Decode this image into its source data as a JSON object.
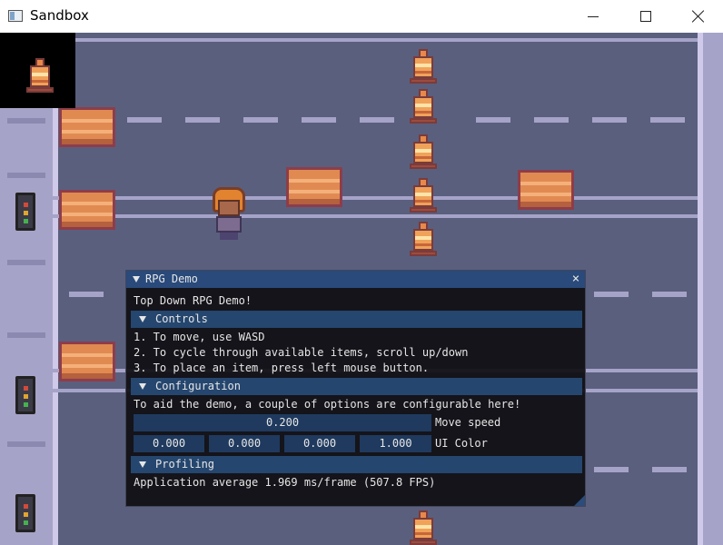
{
  "window": {
    "title": "Sandbox"
  },
  "game": {
    "preview_item": "traffic-cone",
    "colors": {
      "road": "#5a5f7e",
      "sidewalk": "#a6a3c8",
      "panel_bg": "#101014",
      "panel_title": "#294a7a",
      "panel_header": "#25466e",
      "field_bg": "#1f3a5e"
    }
  },
  "imgui": {
    "title": "RPG Demo",
    "intro": "Top Down RPG Demo!",
    "controls": {
      "header": "Controls",
      "lines": [
        "1. To move, use WASD",
        "2. To cycle through available items, scroll up/down",
        "3. To place an item, press left mouse button."
      ]
    },
    "configuration": {
      "header": "Configuration",
      "description": "To aid the demo, a couple of options are configurable here!",
      "move_speed": {
        "value": "0.200",
        "label": "Move speed"
      },
      "ui_color": {
        "values": [
          "0.000",
          "0.000",
          "0.000",
          "1.000"
        ],
        "label": "UI Color"
      }
    },
    "profiling": {
      "header": "Profiling",
      "stats": "Application average 1.969 ms/frame (507.8 FPS)"
    }
  }
}
